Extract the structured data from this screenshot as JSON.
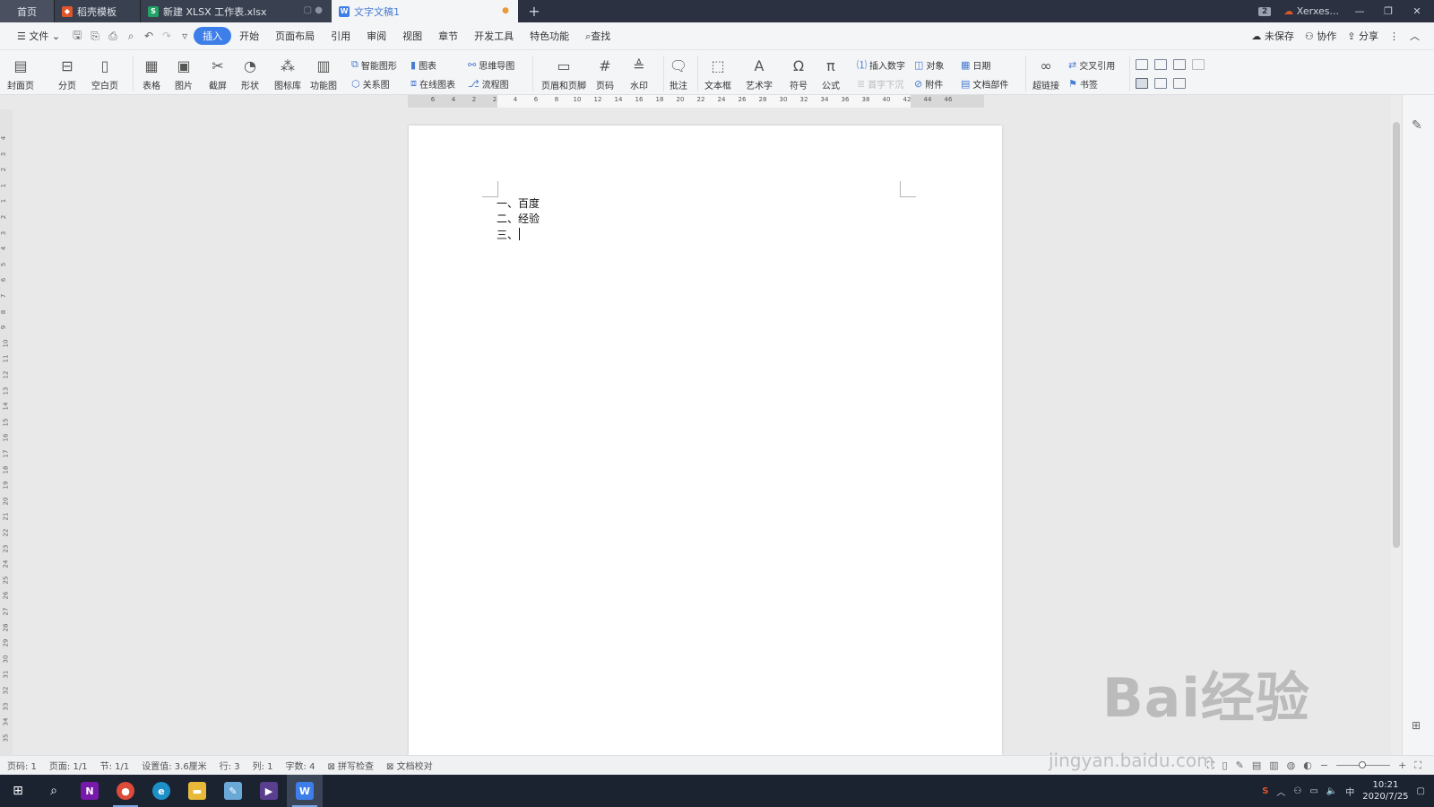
{
  "titlebar": {
    "tabs": [
      {
        "label": "首页"
      },
      {
        "label": "稻壳模板"
      },
      {
        "label": "新建 XLSX 工作表.xlsx"
      },
      {
        "label": "文字文稿1"
      }
    ],
    "new_tab": "+",
    "window_count": "2",
    "user": "Xerxes...",
    "minimize": "—",
    "restore": "❐",
    "close": "✕"
  },
  "menubar": {
    "file": "文件",
    "items": [
      "插入",
      "开始",
      "页面布局",
      "引用",
      "审阅",
      "视图",
      "章节",
      "开发工具",
      "特色功能"
    ],
    "active": "插入",
    "search": "查找",
    "unsaved": "未保存",
    "collab": "协作",
    "share": "分享"
  },
  "ribbon": {
    "cover": "封面页",
    "pagebreak": "分页",
    "blankpage": "空白页",
    "table": "表格",
    "picture": "图片",
    "screenshot": "截屏",
    "shape": "形状",
    "iconlib": "图标库",
    "funcchart": "功能图",
    "smartart": "智能图形",
    "chart": "图表",
    "mindmap": "思维导图",
    "relation": "关系图",
    "onlinechart": "在线图表",
    "flowchart": "流程图",
    "headerfooter": "页眉和页脚",
    "pagenum": "页码",
    "watermark": "水印",
    "comment": "批注",
    "textbox": "文本框",
    "arttext": "艺术字",
    "symbol": "符号",
    "formula": "公式",
    "insertnum": "插入数字",
    "object": "对象",
    "date": "日期",
    "dropcap": "首字下沉",
    "attachment": "附件",
    "docpart": "文档部件",
    "hyperlink": "超链接",
    "crossref": "交叉引用",
    "bookmark": "书签"
  },
  "hruler_ticks": [
    "6",
    "4",
    "2",
    "2",
    "4",
    "6",
    "8",
    "10",
    "12",
    "14",
    "16",
    "18",
    "20",
    "22",
    "24",
    "26",
    "28",
    "30",
    "32",
    "34",
    "36",
    "38",
    "40",
    "42",
    "44",
    "46"
  ],
  "vruler_ticks": [
    "4",
    "3",
    "2",
    "1",
    "1",
    "2",
    "3",
    "4",
    "5",
    "6",
    "7",
    "8",
    "9",
    "10",
    "11",
    "12",
    "13",
    "14",
    "15",
    "16",
    "17",
    "18",
    "19",
    "20",
    "21",
    "22",
    "23",
    "24",
    "25",
    "26",
    "27",
    "28",
    "29",
    "30",
    "31",
    "32",
    "33",
    "34",
    "35"
  ],
  "document": {
    "lines": [
      "一、百度",
      "二、经验",
      "三、"
    ]
  },
  "status": {
    "pagenum": "页码: 1",
    "pages": "页面: 1/1",
    "section": "节: 1/1",
    "setting": "设置值: 3.6厘米",
    "row": "行: 3",
    "col": "列: 1",
    "words": "字数: 4",
    "spellcheck": "拼写检查",
    "proofread": "文档校对"
  },
  "taskbar": {
    "time": "10:21",
    "date": "2020/7/25",
    "ime": "中"
  },
  "watermark": {
    "brand": "Bai经验",
    "url": "jingyan.baidu.com"
  },
  "colors": {
    "accent": "#3d7ee8",
    "titlebar": "#2b3140",
    "taskbar": "#1b2230"
  }
}
